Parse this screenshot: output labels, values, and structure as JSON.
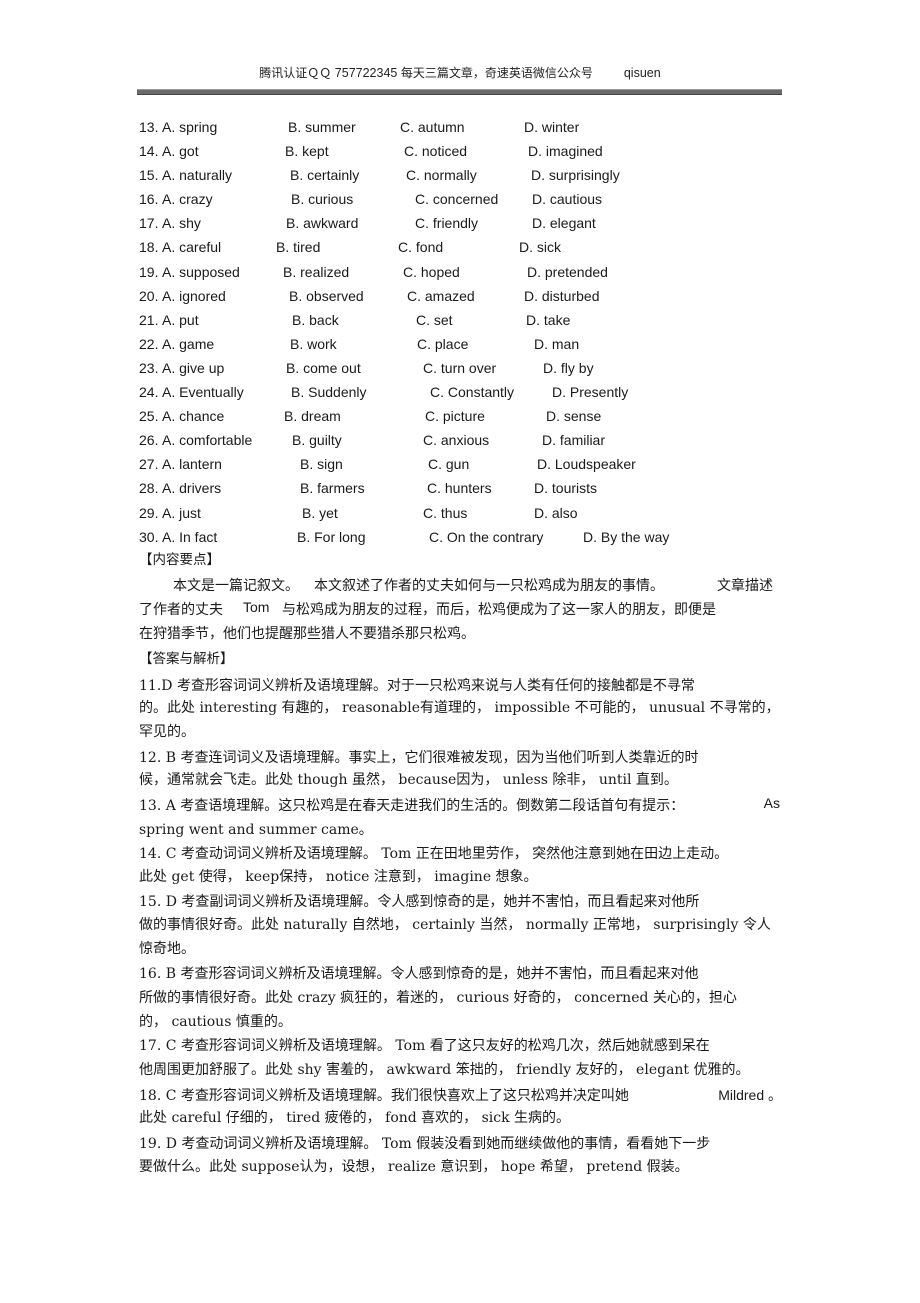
{
  "header": {
    "prefix": "腾讯认证ＱＱ",
    "qq": "757722345",
    "middle": "每天三篇文章，奇速英语微信公众号",
    "account": "qisuen"
  },
  "questions": [
    {
      "num": "13.",
      "a": "A. spring",
      "b": "B. summer",
      "c": "C. autumn",
      "d": "D. winter"
    },
    {
      "num": "14.",
      "a": "A. got",
      "b": "B. kept",
      "c": "C. noticed",
      "d": "D. imagined"
    },
    {
      "num": "15.",
      "a": "A. naturally",
      "b": "B. certainly",
      "c": "C. normally",
      "d": "D. surprisingly"
    },
    {
      "num": "16.",
      "a": "A. crazy",
      "b": "B. curious",
      "c": "C. concerned",
      "d": "D. cautious"
    },
    {
      "num": "17.",
      "a": "A. shy",
      "b": "B. awkward",
      "c": "C. friendly",
      "d": "D. elegant"
    },
    {
      "num": "18.",
      "a": "A. careful",
      "b": "B. tired",
      "c": "C. fond",
      "d": "D. sick"
    },
    {
      "num": "19.",
      "a": "A. supposed",
      "b": "B. realized",
      "c": "C. hoped",
      "d": "D. pretended"
    },
    {
      "num": "20.",
      "a": "A. ignored",
      "b": "B. observed",
      "c": "C. amazed",
      "d": "D. disturbed"
    },
    {
      "num": "21.",
      "a": "A. put",
      "b": "B. back",
      "c": "C. set",
      "d": "D. take"
    },
    {
      "num": "22.",
      "a": "A. game",
      "b": "B. work",
      "c": "C. place",
      "d": "D. man"
    },
    {
      "num": "23.",
      "a": "A. give up",
      "b": "B. come out",
      "c": "C. turn over",
      "d": "D. fly by"
    },
    {
      "num": "24.",
      "a": "A. Eventually",
      "b": "B. Suddenly",
      "c": "C. Constantly",
      "d": "D. Presently"
    },
    {
      "num": "25.",
      "a": "A. chance",
      "b": "B. dream",
      "c": "C. picture",
      "d": "D. sense"
    },
    {
      "num": "26.",
      "a": "A. comfortable",
      "b": "B. guilty",
      "c": "C. anxious",
      "d": "D. familiar"
    },
    {
      "num": "27.",
      "a": "A. lantern",
      "b": "B. sign",
      "c": "C. gun",
      "d": "D. Loudspeaker"
    },
    {
      "num": "28.",
      "a": "A. drivers",
      "b": "B. farmers",
      "c": "C. hunters",
      "d": "D. tourists"
    },
    {
      "num": "29.",
      "a": "A. just",
      "b": "B. yet",
      "c": "C. thus",
      "d": "D. also"
    },
    {
      "num": "30.",
      "a": "A. In fact",
      "b": "B. For long",
      "c": "C. On the contrary",
      "d": "D. By the way"
    }
  ],
  "summary": {
    "heading": "【内容要点】",
    "line1a": "本文是一篇记叙文。",
    "line1b": "本文叙述了作者的丈夫如何与一只松鸡成为朋友的事情。",
    "line1c": "文章描述",
    "line2a": "了作者的丈夫",
    "line2b": "Tom",
    "line2c": "与松鸡成为朋友的过程，而后，松鸡便成为了这一家人的朋友，即便是",
    "line3": "在狩猎季节，他们也提醒那些猎人不要猎杀那只松鸡。"
  },
  "answers": {
    "heading": "【答案与解析】",
    "items": [
      {
        "id": "11",
        "l1": "11.D  考查形容词词义辨析及语境理解。对于一只松鸡来说与人类有任何的接触都是不寻常",
        "l2": "的。此处   interesting 有趣的，  reasonable有道理的，   impossible 不可能的，   unusual 不寻常的，",
        "l3": "罕见的。"
      },
      {
        "id": "12",
        "l1": "12. B  考查连词词义及语境理解。事实上，它们很难被发现，因为当他们听到人类靠近的时",
        "l2": "候，通常就会飞走。此处     though 虽然，  because因为，  unless 除非，  until 直到。"
      },
      {
        "id": "13",
        "l1": "13. A  考查语境理解。这只松鸡是在春天走进我们的生活的。倒数第二段话首句有提示：",
        "l1_right": "As",
        "l2": "spring went and summer came。"
      },
      {
        "id": "14",
        "l1": "14. C  考查动词词义辨析及语境理解。     Tom 正在田地里劳作，   突然他注意到她在田边上走动。",
        "l2": "此处  get 使得，  keep保持，  notice 注意到，   imagine  想象。"
      },
      {
        "id": "15",
        "l1": "15. D  考查副词词义辨析及语境理解。令人感到惊奇的是，她并不害怕，而且看起来对他所",
        "l2": "做的事情很好奇。此处     naturally 自然地，  certainly 当然，  normally 正常地，   surprisingly 令人",
        "l3": "惊奇地。"
      },
      {
        "id": "16",
        "l1": "16. B  考查形容词词义辨析及语境理解。令人感到惊奇的是，她并不害怕，而且看起来对他",
        "l2": "所做的事情很好奇。此处     crazy 疯狂的，着迷的，    curious 好奇的，  concerned 关心的，担心",
        "l3": "的，  cautious 慎重的。"
      },
      {
        "id": "17",
        "l1": "17. C  考查形容词词义辨析及语境理解。      Tom 看了这只友好的松鸡几次，然后她就感到呆在",
        "l2": "他周围更加舒服了。此处     shy 害羞的，   awkward 笨拙的，   friendly  友好的，   elegant 优雅的。"
      },
      {
        "id": "18",
        "l1": "18.  C  考查形容词词义辨析及语境理解。我们很快喜欢上了这只松鸡并决定叫她",
        "l1_right": "Mildred 。",
        "l2": "此处  careful 仔细的，   tired 疲倦的，   fond 喜欢的，   sick  生病的。"
      },
      {
        "id": "19",
        "l1": "19. D  考查动词词义辨析及语境理解。      Tom 假装没看到她而继续做他的事情，看看她下一步",
        "l2": "要做什么。此处    suppose认为，设想，   realize 意识到，  hope 希望，  pretend 假装。"
      }
    ]
  }
}
